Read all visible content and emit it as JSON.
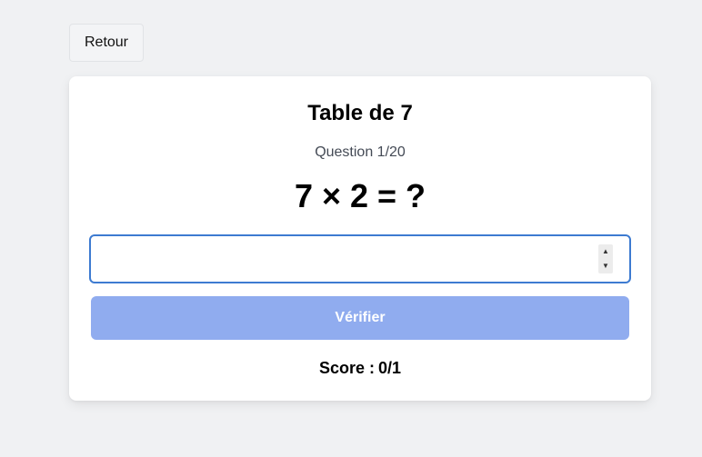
{
  "nav": {
    "back_label": "Retour"
  },
  "quiz": {
    "title": "Table de 7",
    "question_counter": "Question 1/20",
    "equation": "7 × 2 = ?",
    "answer_value": "",
    "answer_placeholder": "",
    "verify_label": "Vérifier",
    "score_label": "Score :",
    "score_value": "0/1"
  },
  "icons": {
    "spinner_up": "triangle-up-icon",
    "spinner_down": "triangle-down-icon"
  },
  "colors": {
    "background": "#f0f1f3",
    "card": "#ffffff",
    "input_focus_border": "#3d7bd1",
    "verify_button_disabled": "#90acef"
  }
}
